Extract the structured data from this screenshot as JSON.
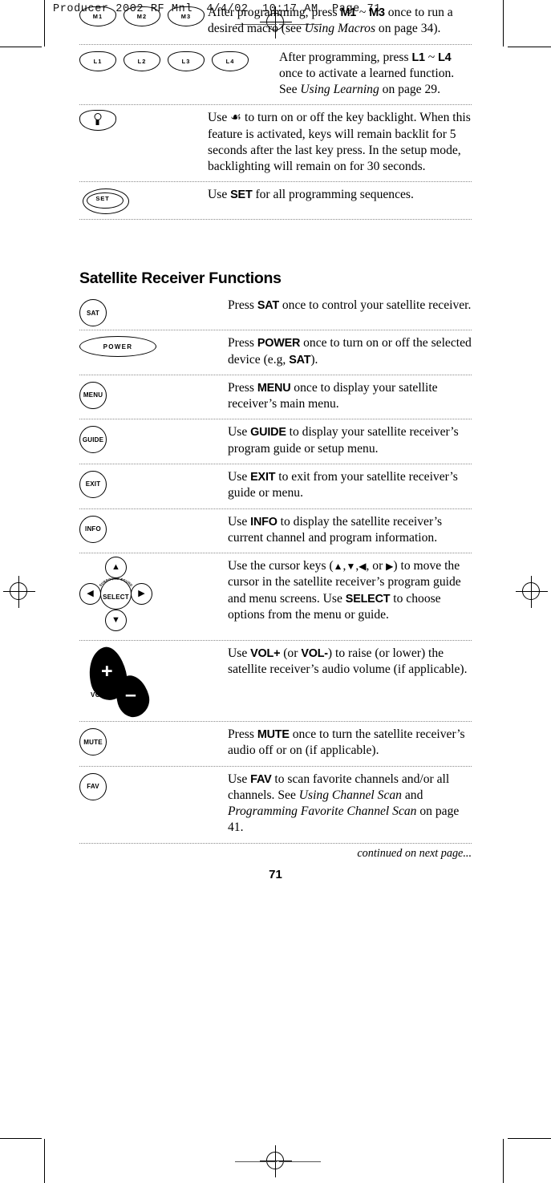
{
  "print_strip": {
    "text": "Producer 2002 RF Mnl  4/4/02  10:17 AM  Page 71"
  },
  "page": {
    "number": "71",
    "continued": "continued on next page...",
    "section_heading": "Satellite Receiver Functions"
  },
  "top_table": {
    "rows": [
      {
        "keys": [
          {
            "name": "macro-key-m1",
            "label": "M1",
            "shape": "oval"
          },
          {
            "name": "macro-key-m2",
            "label": "M2",
            "shape": "oval"
          },
          {
            "name": "macro-key-m3",
            "label": "M3",
            "shape": "oval"
          }
        ],
        "description_html": "After programming, press <b>M1</b> ~ <b>M3</b> once to run a desired macro (see <i>Using Macros</i> on page 34)."
      },
      {
        "keys": [
          {
            "name": "learn-key-l1",
            "label": "L1",
            "shape": "oval"
          },
          {
            "name": "learn-key-l2",
            "label": "L2",
            "shape": "oval"
          },
          {
            "name": "learn-key-l3",
            "label": "L3",
            "shape": "oval"
          },
          {
            "name": "learn-key-l4",
            "label": "L4",
            "shape": "oval"
          }
        ],
        "description_html": "After programming, press <b>L1</b> ~ <b>L4</b> once to activate a learned function. See <i>Using Learning</i> on page 29."
      },
      {
        "keys": [
          {
            "name": "backlight-key",
            "label": "",
            "shape": "oval-bulb",
            "icon": "lightbulb-icon"
          }
        ],
        "description_html": "Use &#9753; to turn on or off the key backlight. When this feature is activated, keys will remain backlit for 5 seconds after the last key press. In the setup mode, backlighting will remain on for 30 seconds."
      },
      {
        "keys": [
          {
            "name": "set-key",
            "label": "SET",
            "shape": "double-oval"
          }
        ],
        "description_html": "Use <b>SET</b> for all programming sequences."
      }
    ]
  },
  "satellite_table": {
    "rows": [
      {
        "keys": [
          {
            "name": "sat-key",
            "label": "SAT",
            "shape": "circle"
          }
        ],
        "description_html": "Press <b>SAT</b> once to control your satellite receiver."
      },
      {
        "keys": [
          {
            "name": "power-key",
            "label": "POWER",
            "shape": "wide-ellipse"
          }
        ],
        "description_html": "Press <b>POWER</b> once to turn on or off the selected device (e.g, <b>SAT</b>)."
      },
      {
        "keys": [
          {
            "name": "menu-key",
            "label": "MENU",
            "shape": "circle"
          }
        ],
        "description_html": "Press <b>MENU</b> once to display your satellite receiver&rsquo;s main menu."
      },
      {
        "keys": [
          {
            "name": "guide-key",
            "label": "GUIDE",
            "shape": "circle"
          }
        ],
        "description_html": "Use <b>GUIDE</b> to display your satellite receiver&rsquo;s program guide or setup menu."
      },
      {
        "keys": [
          {
            "name": "exit-key",
            "label": "EXIT",
            "shape": "circle"
          }
        ],
        "description_html": "Use <b>EXIT</b> to exit from your satellite receiver&rsquo;s guide or menu."
      },
      {
        "keys": [
          {
            "name": "info-key",
            "label": "INFO",
            "shape": "circle"
          }
        ],
        "description_html": "Use <b>INFO</b> to display the satellite receiver&rsquo;s current channel and program information."
      },
      {
        "keys": [
          {
            "name": "cursor-pad",
            "label": "SELECT",
            "shape": "dpad",
            "arc_label": "SURROUND SOUND"
          }
        ],
        "description_html": "Use the cursor keys (<span class=\"arrowglyph\">&#9650;</span>,<span class=\"arrowglyph\">&#9660;</span>,<span class=\"arrowglyph\">&#9664;</span>, or <span class=\"arrowglyph\">&#9654;</span>) to move the cursor in the satellite receiver&rsquo;s program guide and menu screens. Use <b>SELECT</b> to choose options from the menu or guide."
      },
      {
        "keys": [
          {
            "name": "volume-rocker",
            "label": "VOL",
            "shape": "rocker",
            "plus": "+",
            "minus": "–"
          }
        ],
        "description_html": "Use <b>VOL+</b> (or <b>VOL-</b>) to raise (or lower) the satellite receiver&rsquo;s audio volume (if applicable)."
      },
      {
        "keys": [
          {
            "name": "mute-key",
            "label": "MUTE",
            "shape": "circle"
          }
        ],
        "description_html": "Press <b>MUTE</b> once to turn the satellite receiver&rsquo;s audio off or on (if applicable)."
      },
      {
        "keys": [
          {
            "name": "fav-key",
            "label": "FAV",
            "shape": "circle"
          }
        ],
        "description_html": "Use <b>FAV</b> to scan favorite channels and/or all channels. See <i>Using Channel Scan</i> and <i>Programming Favorite Channel Scan</i> on page 41."
      }
    ]
  }
}
